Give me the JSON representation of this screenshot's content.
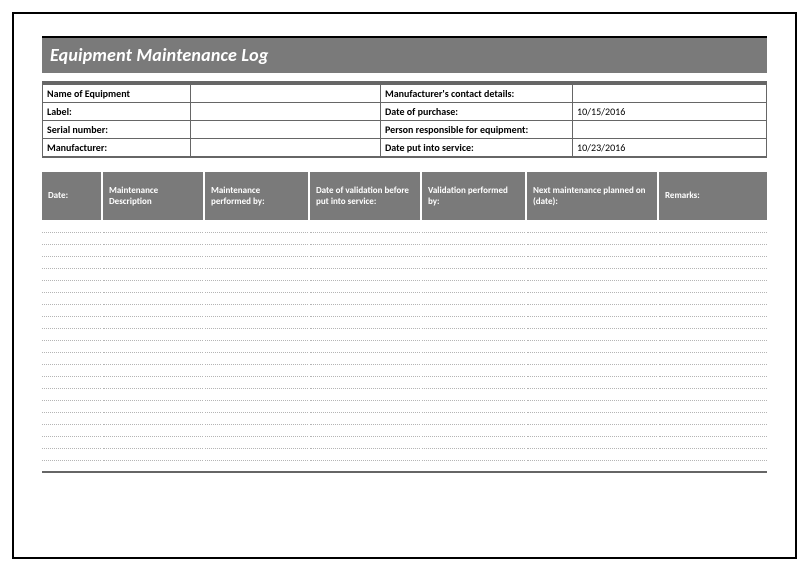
{
  "title": "Equipment Maintenance Log",
  "header": {
    "row1": {
      "label_a": "Name of Equipment",
      "value_a": "",
      "label_b": "Manufacturer's contact details:",
      "value_b": ""
    },
    "row2": {
      "label_a": "Label:",
      "value_a": "",
      "label_b": "Date of purchase:",
      "value_b": "10/15/2016"
    },
    "row3": {
      "label_a": "Serial number:",
      "value_a": "",
      "label_b": "Person responsible for equipment:",
      "value_b": ""
    },
    "row4": {
      "label_a": "Manufacturer:",
      "value_a": "",
      "label_b": "Date put into service:",
      "value_b": "10/23/2016"
    }
  },
  "log_columns": [
    "Date:",
    "Maintenance Description",
    "Maintenance performed by:",
    "Date of validation before put into service:",
    "Validation performed by:",
    "Next maintenance planned on (date):",
    "Remarks:"
  ],
  "log_row_count": 21
}
